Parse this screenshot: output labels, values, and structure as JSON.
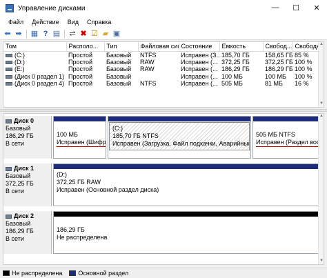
{
  "window": {
    "title": "Управление дисками"
  },
  "menu": [
    "Файл",
    "Действие",
    "Вид",
    "Справка"
  ],
  "volumes": {
    "columns": [
      "Том",
      "Располо...",
      "Тип",
      "Файловая сис...",
      "Состояние",
      "Емкость",
      "Свобод...",
      "Свободно %"
    ],
    "rows": [
      [
        "(C:)",
        "Простой",
        "Базовый",
        "NTFS",
        "Исправен (З...",
        "185,70 ГБ",
        "158,65 ГБ",
        "85 %"
      ],
      [
        "(D:)",
        "Простой",
        "Базовый",
        "RAW",
        "Исправен (...",
        "372,25 ГБ",
        "372,25 ГБ",
        "100 %"
      ],
      [
        "(E:)",
        "Простой",
        "Базовый",
        "RAW",
        "Исправен (...",
        "186,29 ГБ",
        "186,29 ГБ",
        "100 %"
      ],
      [
        "(Диск 0 раздел 1)",
        "Простой",
        "Базовый",
        "",
        "Исправен (...",
        "100 МБ",
        "100 МБ",
        "100 %"
      ],
      [
        "(Диск 0 раздел 4)",
        "Простой",
        "Базовый",
        "NTFS",
        "Исправен (...",
        "505 МБ",
        "81 МБ",
        "16 %"
      ]
    ]
  },
  "disks": [
    {
      "name": "Диск 0",
      "type": "Базовый",
      "size": "186,29 ГБ",
      "status": "В сети",
      "partitions": [
        {
          "label": "",
          "size": "100 МБ",
          "status": "Исправен (Шифро"
        },
        {
          "label": "(C:)",
          "size": "185,70 ГБ NTFS",
          "status": "Исправен (Загрузка, Файл подкачки, Аварийный да"
        },
        {
          "label": "",
          "size": "505 МБ NTFS",
          "status": "Исправен (Раздел восстан"
        }
      ]
    },
    {
      "name": "Диск 1",
      "type": "Базовый",
      "size": "372,25 ГБ",
      "status": "В сети",
      "partitions": [
        {
          "label": "(D:)",
          "size": "372,25 ГБ RAW",
          "status": "Исправен (Основной раздел диска)"
        }
      ]
    },
    {
      "name": "Диск 2",
      "type": "Базовый",
      "size": "186,29 ГБ",
      "status": "В сети",
      "partitions": [
        {
          "label": "",
          "size": "186,29 ГБ",
          "status": "Не распределена"
        }
      ]
    }
  ],
  "legend": [
    {
      "label": "Не распределена",
      "color": "#000000"
    },
    {
      "label": "Основной раздел",
      "color": "#1e2a7a"
    }
  ]
}
